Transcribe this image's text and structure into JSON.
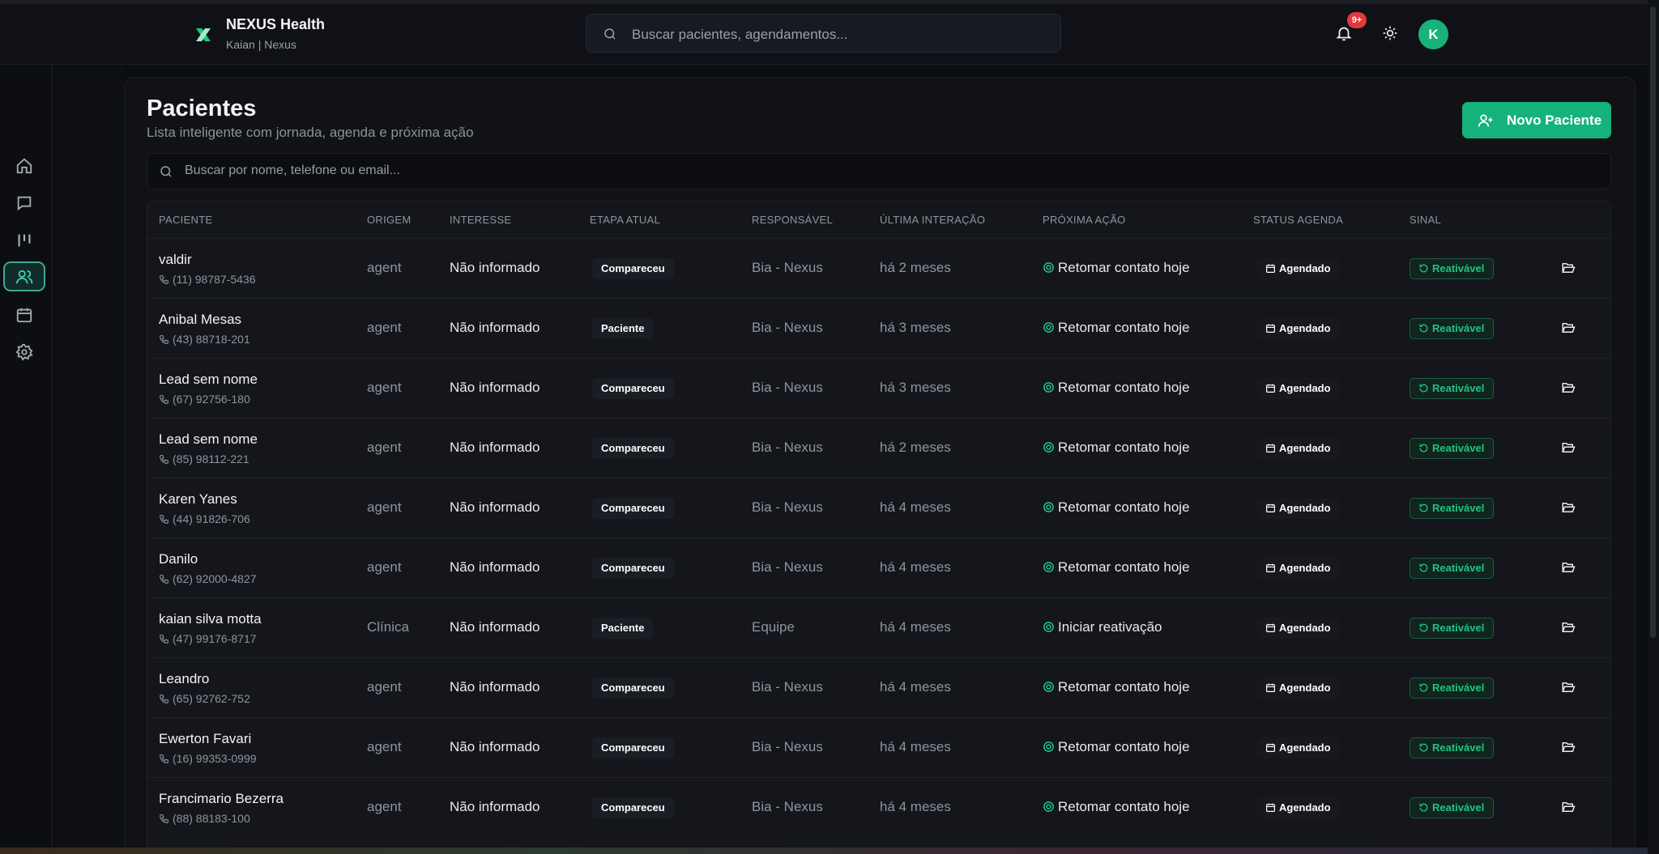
{
  "header": {
    "brand_name": "NEXUS Health",
    "brand_sub": "Kaian | Nexus",
    "search_placeholder": "Buscar pacientes, agendamentos...",
    "notifications_badge": "9+",
    "avatar_initial": "K",
    "accent_color": "#15b37b"
  },
  "sidebar": {
    "items": [
      {
        "icon": "home-icon"
      },
      {
        "icon": "chat-icon"
      },
      {
        "icon": "kanban-icon"
      },
      {
        "icon": "users-icon",
        "active": true
      },
      {
        "icon": "calendar-icon"
      },
      {
        "icon": "gear-icon"
      }
    ]
  },
  "main": {
    "title": "Pacientes",
    "subtitle": "Lista inteligente com jornada, agenda e próxima ação",
    "new_button_label": "Novo Paciente",
    "search_placeholder": "Buscar por nome, telefone ou email..."
  },
  "table": {
    "columns": [
      "PACIENTE",
      "ORIGEM",
      "INTERESSE",
      "ETAPA ATUAL",
      "RESPONSÁVEL",
      "ÚLTIMA INTERAÇÃO",
      "PRÓXIMA AÇÃO",
      "STATUS AGENDA",
      "SINAL"
    ],
    "rows": [
      {
        "name": "valdir",
        "phone": "(11) 98787-5436",
        "origem": "agent",
        "interesse": "Não informado",
        "etapa": "Compareceu",
        "responsavel": "Bia - Nexus",
        "ultima": "há 2 meses",
        "proxima": "Retomar contato hoje",
        "status": "Agendado",
        "sinal": "Reativável"
      },
      {
        "name": "Anibal Mesas",
        "phone": "(43) 88718-201",
        "origem": "agent",
        "interesse": "Não informado",
        "etapa": "Paciente",
        "responsavel": "Bia - Nexus",
        "ultima": "há 3 meses",
        "proxima": "Retomar contato hoje",
        "status": "Agendado",
        "sinal": "Reativável"
      },
      {
        "name": "Lead sem nome",
        "phone": "(67) 92756-180",
        "origem": "agent",
        "interesse": "Não informado",
        "etapa": "Compareceu",
        "responsavel": "Bia - Nexus",
        "ultima": "há 3 meses",
        "proxima": "Retomar contato hoje",
        "status": "Agendado",
        "sinal": "Reativável"
      },
      {
        "name": "Lead sem nome",
        "phone": "(85) 98112-221",
        "origem": "agent",
        "interesse": "Não informado",
        "etapa": "Compareceu",
        "responsavel": "Bia - Nexus",
        "ultima": "há 2 meses",
        "proxima": "Retomar contato hoje",
        "status": "Agendado",
        "sinal": "Reativável"
      },
      {
        "name": "Karen Yanes",
        "phone": "(44) 91826-706",
        "origem": "agent",
        "interesse": "Não informado",
        "etapa": "Compareceu",
        "responsavel": "Bia - Nexus",
        "ultima": "há 4 meses",
        "proxima": "Retomar contato hoje",
        "status": "Agendado",
        "sinal": "Reativável"
      },
      {
        "name": "Danilo",
        "phone": "(62) 92000-4827",
        "origem": "agent",
        "interesse": "Não informado",
        "etapa": "Compareceu",
        "responsavel": "Bia - Nexus",
        "ultima": "há 4 meses",
        "proxima": "Retomar contato hoje",
        "status": "Agendado",
        "sinal": "Reativável"
      },
      {
        "name": "kaian silva motta",
        "phone": "(47) 99176-8717",
        "origem": "Clínica",
        "interesse": "Não informado",
        "etapa": "Paciente",
        "responsavel": "Equipe",
        "ultima": "há 4 meses",
        "proxima": "Iniciar reativação",
        "status": "Agendado",
        "sinal": "Reativável"
      },
      {
        "name": "Leandro",
        "phone": "(65) 92762-752",
        "origem": "agent",
        "interesse": "Não informado",
        "etapa": "Compareceu",
        "responsavel": "Bia - Nexus",
        "ultima": "há 4 meses",
        "proxima": "Retomar contato hoje",
        "status": "Agendado",
        "sinal": "Reativável"
      },
      {
        "name": "Ewerton Favari",
        "phone": "(16) 99353-0999",
        "origem": "agent",
        "interesse": "Não informado",
        "etapa": "Compareceu",
        "responsavel": "Bia - Nexus",
        "ultima": "há 4 meses",
        "proxima": "Retomar contato hoje",
        "status": "Agendado",
        "sinal": "Reativável"
      },
      {
        "name": "Francimario Bezerra",
        "phone": "(88) 88183-100",
        "origem": "agent",
        "interesse": "Não informado",
        "etapa": "Compareceu",
        "responsavel": "Bia - Nexus",
        "ultima": "há 4 meses",
        "proxima": "Retomar contato hoje",
        "status": "Agendado",
        "sinal": "Reativável"
      }
    ]
  }
}
